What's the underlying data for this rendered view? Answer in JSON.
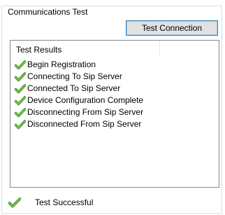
{
  "group": {
    "title": "Communications Test"
  },
  "toolbar": {
    "test_button_label": "Test Connection"
  },
  "results": {
    "header": "Test Results",
    "items": [
      {
        "label": "Begin Registration",
        "icon": "check-icon"
      },
      {
        "label": "Connecting To Sip Server",
        "icon": "check-icon"
      },
      {
        "label": "Connected To Sip Server",
        "icon": "check-icon"
      },
      {
        "label": "Device Configuration Complete",
        "icon": "check-icon"
      },
      {
        "label": "Disconnecting From Sip Server",
        "icon": "check-icon"
      },
      {
        "label": "Disconnected From Sip Server",
        "icon": "check-icon"
      }
    ]
  },
  "status": {
    "text": "Test Successful",
    "icon": "check-icon"
  },
  "colors": {
    "check_green": "#5fb33b",
    "check_dark": "#3d8a22",
    "button_border": "#3c7fb1",
    "list_border": "#828790"
  }
}
